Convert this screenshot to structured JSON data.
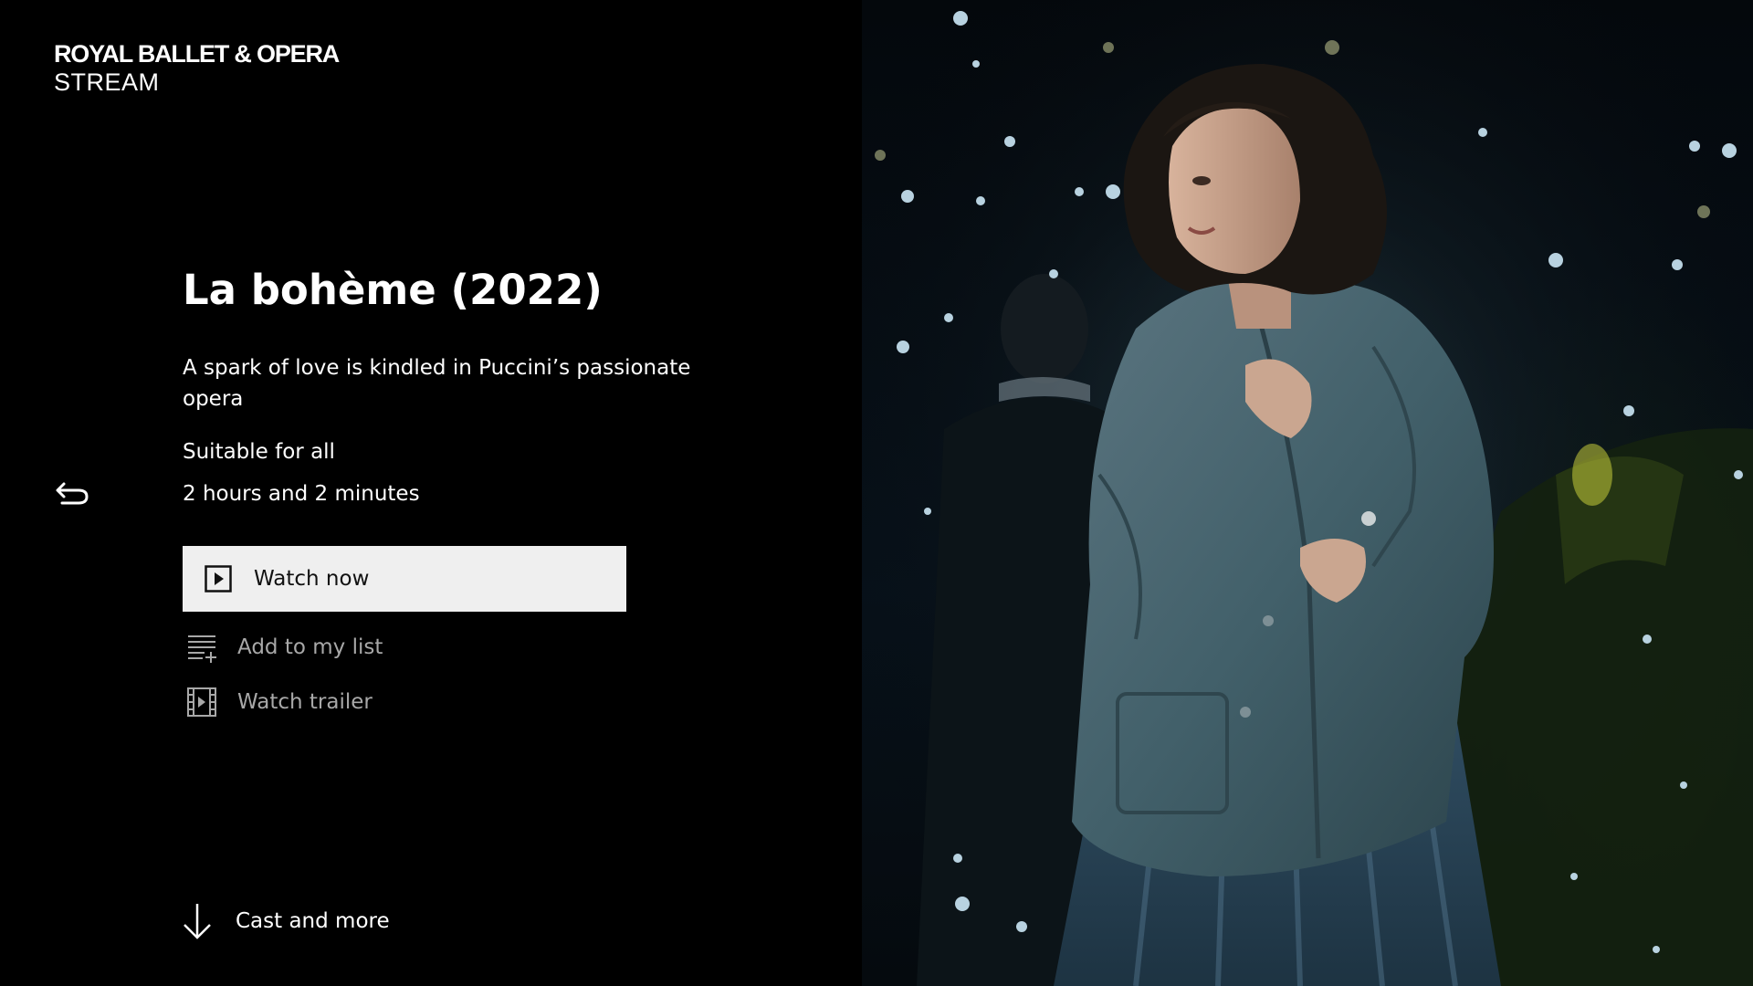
{
  "brand": {
    "line1": "ROYAL BALLET & OPERA",
    "line2": "STREAM"
  },
  "production": {
    "title": "La bohème (2022)",
    "synopsis": "A spark of love is kindled in Puccini’s passionate opera",
    "rating": "Suitable for all",
    "duration": "2 hours and 2 minutes"
  },
  "actions": {
    "watch_now": "Watch now",
    "add_to_list": "Add to my list",
    "watch_trailer": "Watch trailer",
    "cast_and_more": "Cast and more"
  },
  "icons": {
    "back": "back-arrow-icon",
    "play": "play-icon",
    "add_list": "playlist-add-icon",
    "trailer": "film-strip-icon",
    "down": "arrow-down-icon"
  },
  "colors": {
    "background": "#000000",
    "primary_button": "#efefef",
    "secondary_text": "#a8a8a8",
    "text": "#ffffff"
  }
}
